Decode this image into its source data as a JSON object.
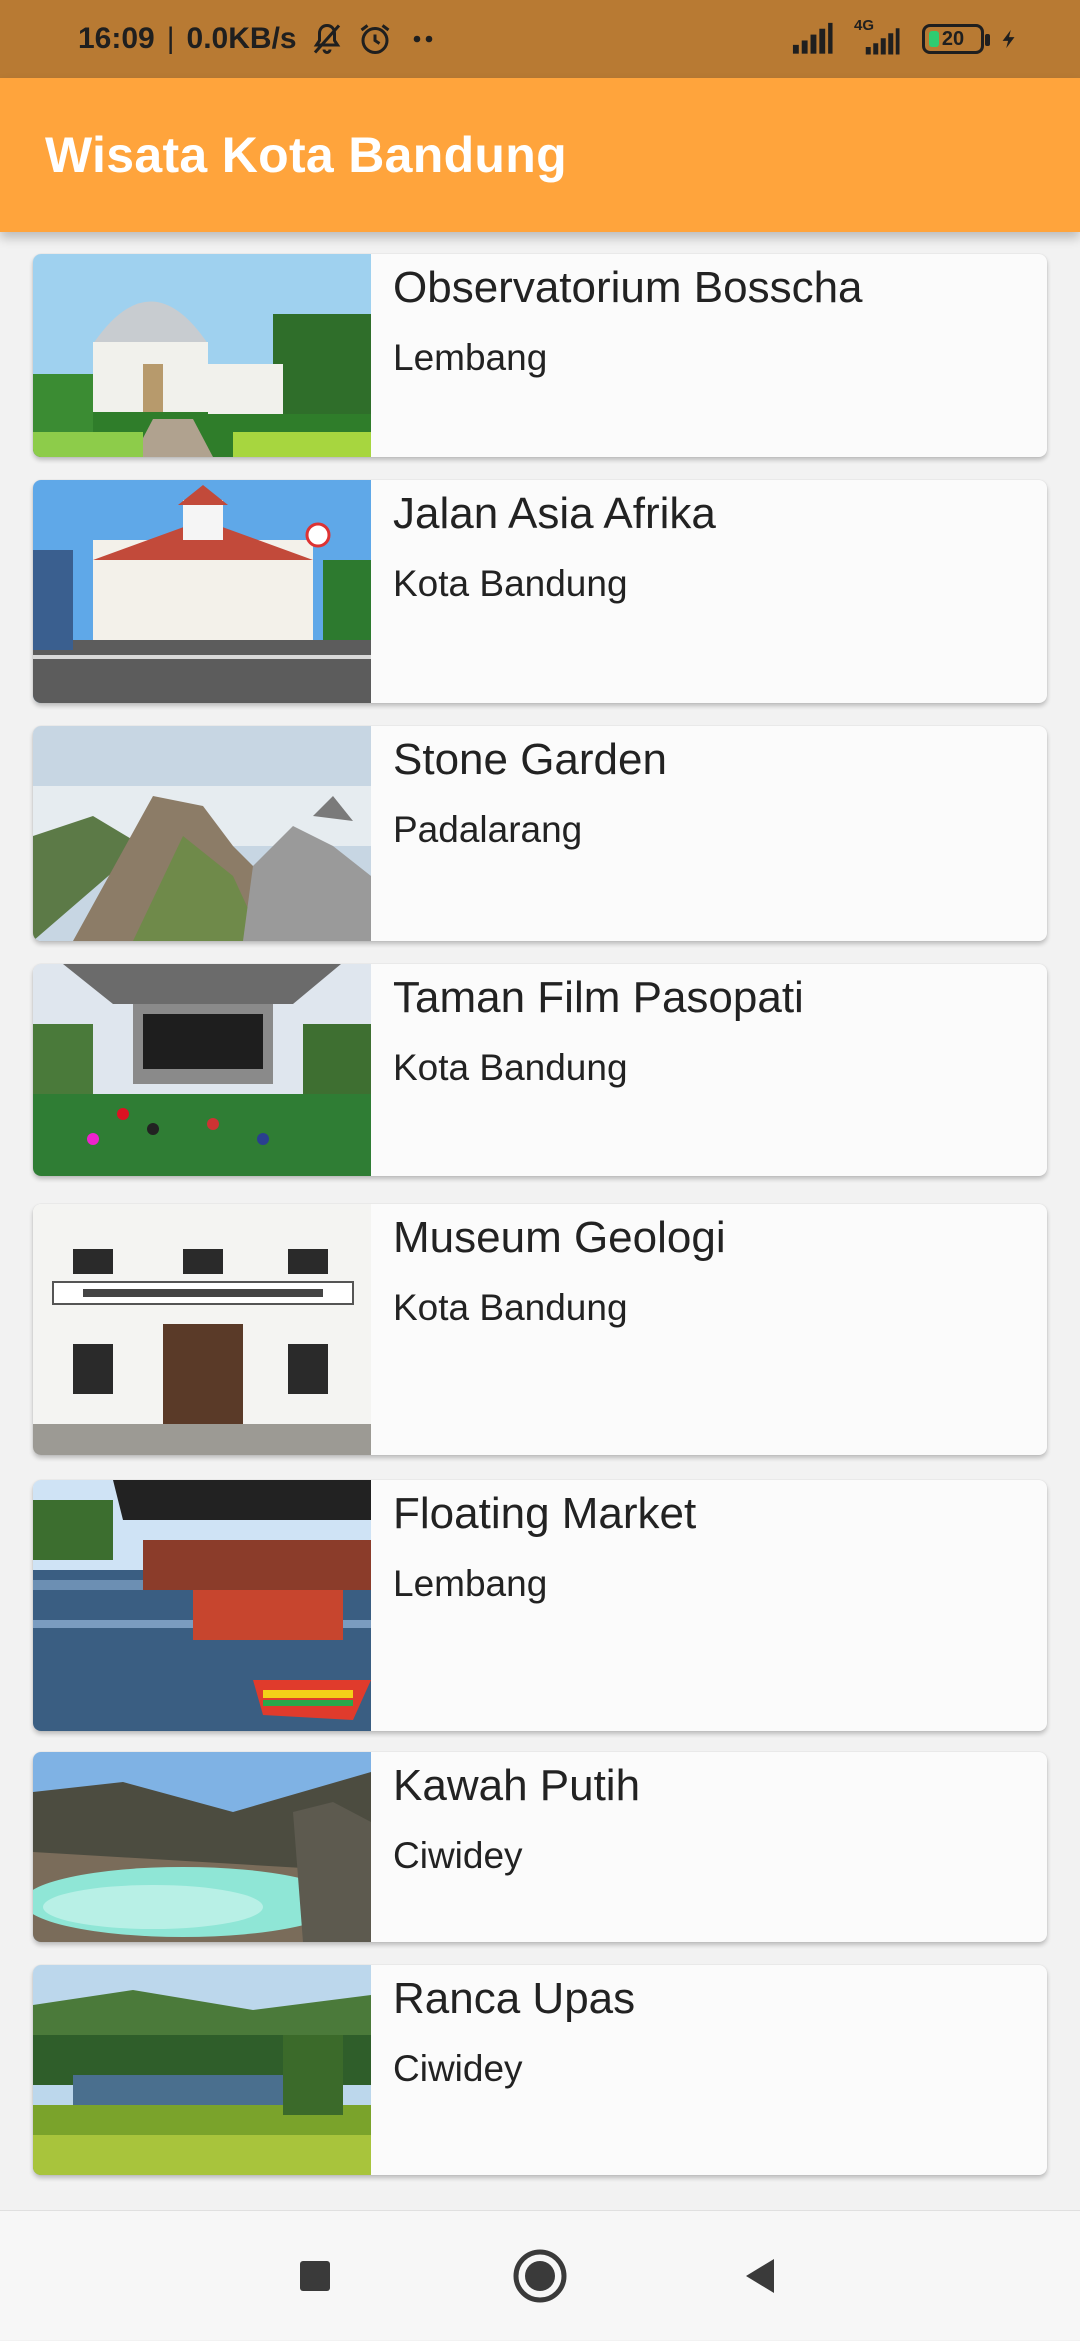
{
  "status_bar": {
    "time": "16:09",
    "speed": "0.0KB/s",
    "network_label": "4G",
    "battery": "20",
    "icons": [
      "mute-bell-icon",
      "alarm-icon",
      "more-dots-icon",
      "signal-icon",
      "signal-4g-icon",
      "battery-icon",
      "charging-bolt-icon"
    ]
  },
  "app_bar": {
    "title": "Wisata Kota Bandung",
    "color": "#ffa43c"
  },
  "places": [
    {
      "name": "Observatorium Bosscha",
      "location": "Lembang"
    },
    {
      "name": "Jalan Asia Afrika",
      "location": "Kota Bandung"
    },
    {
      "name": "Stone Garden",
      "location": "Padalarang"
    },
    {
      "name": "Taman Film Pasopati",
      "location": "Kota Bandung"
    },
    {
      "name": "Museum Geologi",
      "location": "Kota Bandung"
    },
    {
      "name": "Floating Market",
      "location": "Lembang"
    },
    {
      "name": "Kawah Putih",
      "location": "Ciwidey"
    },
    {
      "name": "Ranca Upas",
      "location": "Ciwidey"
    }
  ],
  "nav_bar": {
    "icons": [
      "recents-square-icon",
      "home-circle-icon",
      "back-triangle-icon"
    ]
  }
}
